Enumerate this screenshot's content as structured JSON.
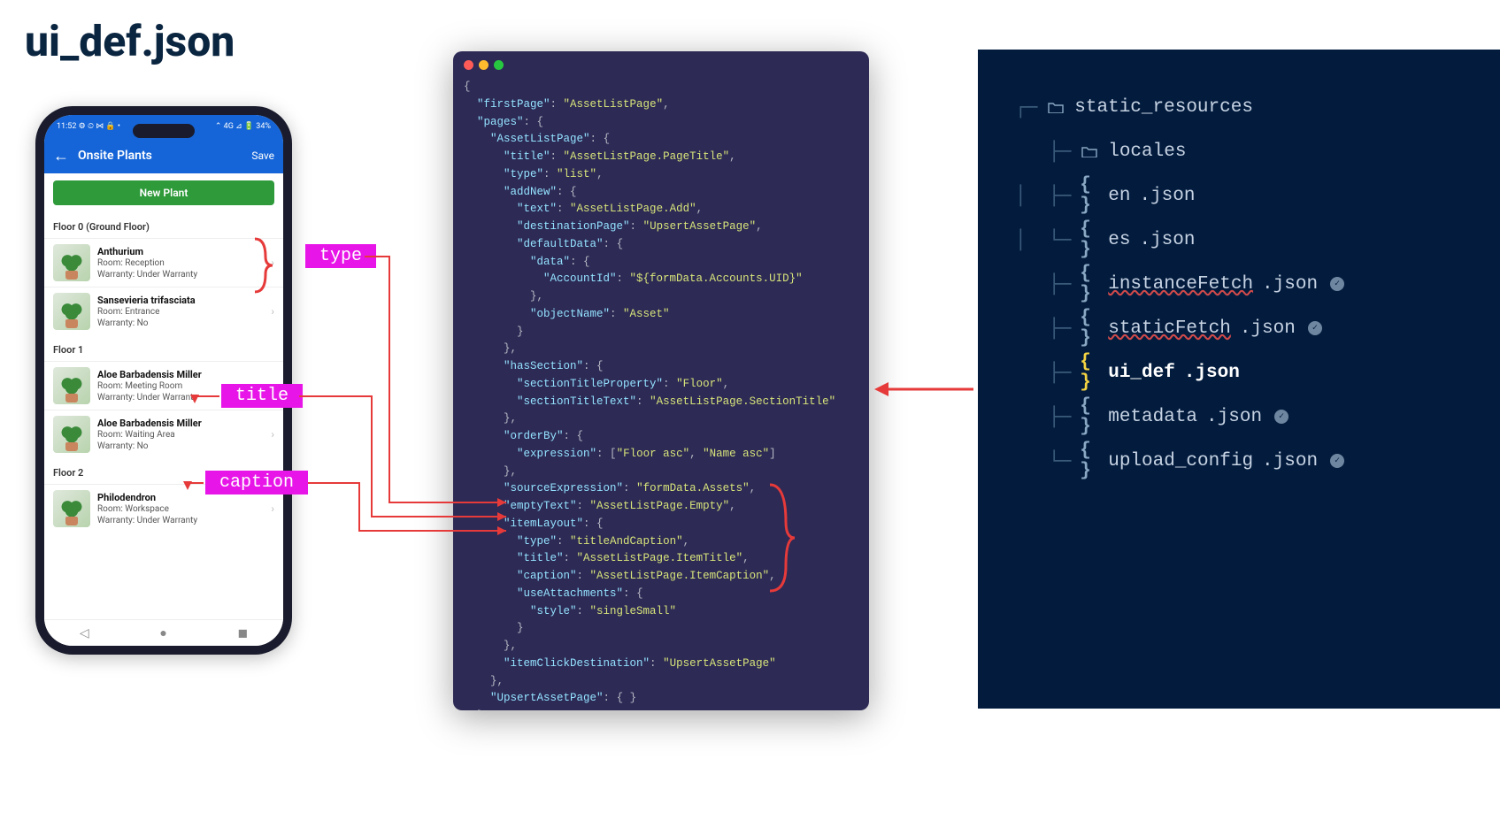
{
  "pageTitle": "ui_def.json",
  "phone": {
    "status_left": "11:52 ⚙ ⏲ ⋈ 🔒 •",
    "status_right": "⌃ 4G ⊿ 🔋 34%",
    "app_title": "Onsite Plants",
    "save_label": "Save",
    "new_button": "New Plant",
    "sections": [
      {
        "header": "Floor 0 (Ground Floor)",
        "items": [
          {
            "title": "Anthurium",
            "line1": "Room: Reception",
            "line2": "Warranty: Under Warranty"
          },
          {
            "title": "Sansevieria trifasciata",
            "line1": "Room: Entrance",
            "line2": "Warranty: No"
          }
        ]
      },
      {
        "header": "Floor 1",
        "items": [
          {
            "title": "Aloe Barbadensis Miller",
            "line1": "Room: Meeting Room",
            "line2": "Warranty: Under Warranty"
          },
          {
            "title": "Aloe Barbadensis Miller",
            "line1": "Room: Waiting Area",
            "line2": "Warranty: No"
          }
        ]
      },
      {
        "header": "Floor 2",
        "items": [
          {
            "title": "Philodendron",
            "line1": "Room: Workspace",
            "line2": "Warranty: Under Warranty"
          }
        ]
      }
    ]
  },
  "tags": {
    "type": "type",
    "title": "title",
    "caption": "caption"
  },
  "code_json": {
    "firstPage": "AssetListPage",
    "pages": {
      "AssetListPage": {
        "title": "AssetListPage.PageTitle",
        "type": "list",
        "addNew": {
          "text": "AssetListPage.Add",
          "destinationPage": "UpsertAssetPage",
          "defaultData": {
            "data": {
              "AccountId": "${formData.Accounts.UID}"
            },
            "objectName": "Asset"
          }
        },
        "hasSection": {
          "sectionTitleProperty": "Floor",
          "sectionTitleText": "AssetListPage.SectionTitle"
        },
        "orderBy": {
          "expression": [
            "Floor asc",
            "Name asc"
          ]
        },
        "sourceExpression": "formData.Assets",
        "emptyText": "AssetListPage.Empty",
        "itemLayout": {
          "type": "titleAndCaption",
          "title": "AssetListPage.ItemTitle",
          "caption": "AssetListPage.ItemCaption",
          "useAttachments": {
            "style": "singleSmall"
          }
        },
        "itemClickDestination": "UpsertAssetPage"
      },
      "UpsertAssetPage": {}
    }
  },
  "tree": {
    "rows": [
      {
        "indent": 0,
        "type": "folder",
        "name": "static_resources"
      },
      {
        "indent": 1,
        "type": "folder",
        "name": "locales"
      },
      {
        "indent": 2,
        "type": "file",
        "name": "en",
        "ext": ".json"
      },
      {
        "indent": 2,
        "type": "file",
        "name": "es",
        "ext": ".json",
        "last_in_branch": true
      },
      {
        "indent": 1,
        "type": "file",
        "name": "instanceFetch",
        "ext": ".json",
        "underline": true,
        "check": true
      },
      {
        "indent": 1,
        "type": "file",
        "name": "staticFetch",
        "ext": ".json",
        "underline": true,
        "check": true
      },
      {
        "indent": 1,
        "type": "file",
        "name": "ui_def",
        "ext": ".json",
        "selected": true
      },
      {
        "indent": 1,
        "type": "file",
        "name": "metadata",
        "ext": ".json",
        "check": true
      },
      {
        "indent": 1,
        "type": "file",
        "name": "upload_config",
        "ext": ".json",
        "check": true,
        "last_in_branch": true
      }
    ]
  }
}
